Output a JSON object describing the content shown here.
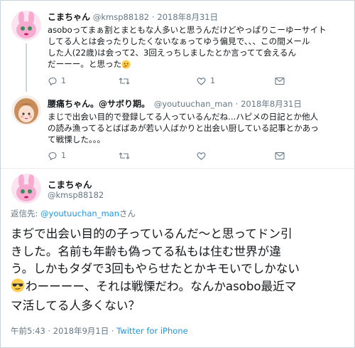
{
  "tweet1": {
    "name": "こまちゃん",
    "handle": "@kmsp88182",
    "separator": "·",
    "date": "2018年8月31日",
    "text_line1": "asoboってまぁ割とまともな人多いと思うんだけどやっぱりこーゆーサイト",
    "text_line2": "してる人とは会ったりしたくないなぁってゆう偏見で、、、この間メール",
    "text_line3": "した人(22歳)は会って2、3回えっちしましたとか言ってて会えるん",
    "text_line4": "だーーー。と思った",
    "reply_count": "1",
    "like_count": "1"
  },
  "tweet2": {
    "name": "腰痛ちゃん。@サボり期。",
    "handle": "@youtuuchan_man",
    "separator": "·",
    "date": "2018年8月31日",
    "text_line1": "まじで出会い目的で登録してる人っているんだね...ハピメの日記とか他人",
    "text_line2": "の読み漁ってるとばばあが若い人ばかりと出会い厨している記事とかあっ",
    "text_line3": "て戦慄した。。。",
    "reply_count": "1"
  },
  "main": {
    "name": "こまちゃん",
    "handle": "@kmsp88182",
    "reply_prefix": "返信先: ",
    "reply_handle": "@youtuuchan_man",
    "reply_suffix": "さん",
    "text_line1": "まぢで出会い目的の子っているんだ〜と思ってドン引",
    "text_line2": "きした。名前も年齢も偽ってる私もは住む世界が違",
    "text_line3": "う。しかもタダで3回もやらせたとかキモいでしかない",
    "text_line4": "わーーーー、それは戦慄だわ。なんかasobo最近マ",
    "text_line5": "マ活してる人多くない？",
    "time": "午前5:43",
    "separator": "·",
    "date": "2018年9月1日",
    "dot2": "·",
    "source": "Twitter for iPhone"
  },
  "colors": {
    "link": "#1b95e0",
    "muted": "#657786",
    "text": "#14171a"
  },
  "icons": [
    "reply-icon",
    "retweet-icon",
    "like-icon",
    "dm-icon",
    "thinking-emoji",
    "sunglasses-emoji"
  ]
}
